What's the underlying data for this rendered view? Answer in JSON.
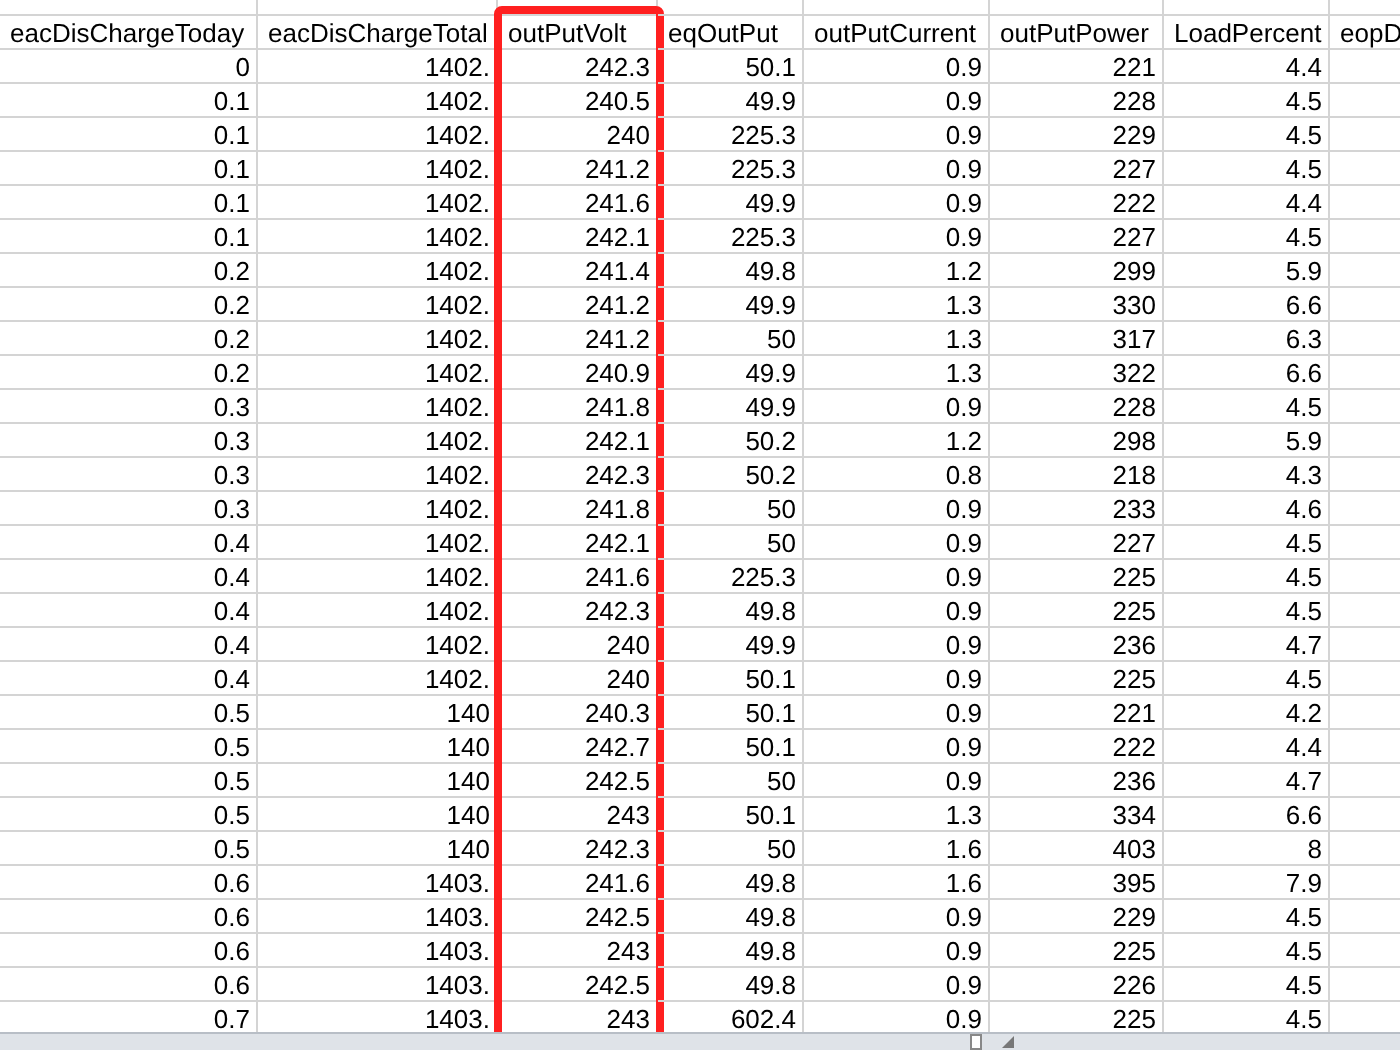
{
  "columns": [
    {
      "header": "eacDisChargeToday",
      "highlighted": false
    },
    {
      "header": "eacDisChargeTotal",
      "highlighted": false
    },
    {
      "header": "outPutVolt",
      "highlighted": true
    },
    {
      "header": "eqOutPut",
      "highlighted": false
    },
    {
      "header": "outPutCurrent",
      "highlighted": false
    },
    {
      "header": "outPutPower",
      "highlighted": false
    },
    {
      "header": "LoadPercent",
      "highlighted": false
    },
    {
      "header": "eopD",
      "highlighted": false
    }
  ],
  "rows": [
    [
      "0",
      "1402.",
      "242.3",
      "50.1",
      "0.9",
      "221",
      "4.4"
    ],
    [
      "0.1",
      "1402.",
      "240.5",
      "49.9",
      "0.9",
      "228",
      "4.5"
    ],
    [
      "0.1",
      "1402.",
      "240",
      "225.3",
      "0.9",
      "229",
      "4.5"
    ],
    [
      "0.1",
      "1402.",
      "241.2",
      "225.3",
      "0.9",
      "227",
      "4.5"
    ],
    [
      "0.1",
      "1402.",
      "241.6",
      "49.9",
      "0.9",
      "222",
      "4.4"
    ],
    [
      "0.1",
      "1402.",
      "242.1",
      "225.3",
      "0.9",
      "227",
      "4.5"
    ],
    [
      "0.2",
      "1402.",
      "241.4",
      "49.8",
      "1.2",
      "299",
      "5.9"
    ],
    [
      "0.2",
      "1402.",
      "241.2",
      "49.9",
      "1.3",
      "330",
      "6.6"
    ],
    [
      "0.2",
      "1402.",
      "241.2",
      "50",
      "1.3",
      "317",
      "6.3"
    ],
    [
      "0.2",
      "1402.",
      "240.9",
      "49.9",
      "1.3",
      "322",
      "6.6"
    ],
    [
      "0.3",
      "1402.",
      "241.8",
      "49.9",
      "0.9",
      "228",
      "4.5"
    ],
    [
      "0.3",
      "1402.",
      "242.1",
      "50.2",
      "1.2",
      "298",
      "5.9"
    ],
    [
      "0.3",
      "1402.",
      "242.3",
      "50.2",
      "0.8",
      "218",
      "4.3"
    ],
    [
      "0.3",
      "1402.",
      "241.8",
      "50",
      "0.9",
      "233",
      "4.6"
    ],
    [
      "0.4",
      "1402.",
      "242.1",
      "50",
      "0.9",
      "227",
      "4.5"
    ],
    [
      "0.4",
      "1402.",
      "241.6",
      "225.3",
      "0.9",
      "225",
      "4.5"
    ],
    [
      "0.4",
      "1402.",
      "242.3",
      "49.8",
      "0.9",
      "225",
      "4.5"
    ],
    [
      "0.4",
      "1402.",
      "240",
      "49.9",
      "0.9",
      "236",
      "4.7"
    ],
    [
      "0.4",
      "1402.",
      "240",
      "50.1",
      "0.9",
      "225",
      "4.5"
    ],
    [
      "0.5",
      "140",
      "240.3",
      "50.1",
      "0.9",
      "221",
      "4.2"
    ],
    [
      "0.5",
      "140",
      "242.7",
      "50.1",
      "0.9",
      "222",
      "4.4"
    ],
    [
      "0.5",
      "140",
      "242.5",
      "50",
      "0.9",
      "236",
      "4.7"
    ],
    [
      "0.5",
      "140",
      "243",
      "50.1",
      "1.3",
      "334",
      "6.6"
    ],
    [
      "0.5",
      "140",
      "242.3",
      "50",
      "1.6",
      "403",
      "8"
    ],
    [
      "0.6",
      "1403.",
      "241.6",
      "49.8",
      "1.6",
      "395",
      "7.9"
    ],
    [
      "0.6",
      "1403.",
      "242.5",
      "49.8",
      "0.9",
      "229",
      "4.5"
    ],
    [
      "0.6",
      "1403.",
      "243",
      "49.8",
      "0.9",
      "225",
      "4.5"
    ],
    [
      "0.6",
      "1403.",
      "242.5",
      "49.8",
      "0.9",
      "226",
      "4.5"
    ],
    [
      "0.7",
      "1403.",
      "243",
      "602.4",
      "0.9",
      "225",
      "4.5"
    ]
  ]
}
